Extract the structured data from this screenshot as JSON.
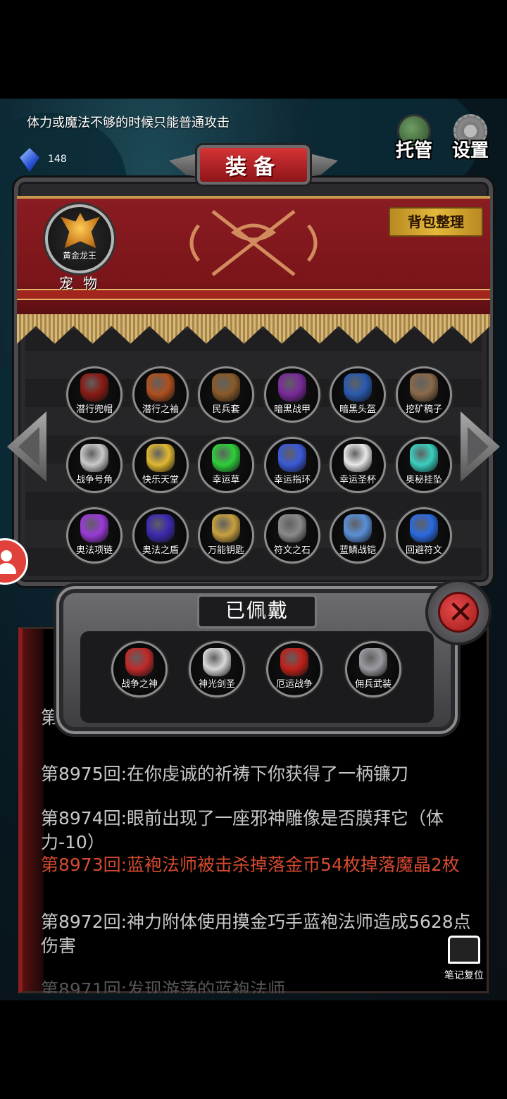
{
  "hint": "体力或魔法不够的时候只能普通攻击",
  "resource": {
    "icon": "crystal-gem-icon",
    "value": "148"
  },
  "top_buttons": [
    {
      "label": "托管",
      "icon": "auto-play-icon"
    },
    {
      "label": "设置",
      "icon": "gear-icon"
    }
  ],
  "panel": {
    "title": "装备",
    "sort_button": "背包整理",
    "pet": {
      "name": "黄金龙王",
      "label": "宠 物"
    }
  },
  "items": [
    {
      "label": "潜行兜帽",
      "icon": "hood-icon",
      "color": "#8a1a14"
    },
    {
      "label": "潜行之袖",
      "icon": "sleeve-icon",
      "color": "#b0501e"
    },
    {
      "label": "民兵套",
      "icon": "militia-set-icon",
      "color": "#8a5a2a"
    },
    {
      "label": "暗黑战甲",
      "icon": "dark-armor-icon",
      "color": "#7a2a9a"
    },
    {
      "label": "暗黑头盔",
      "icon": "dark-helmet-icon",
      "color": "#2a5ab0"
    },
    {
      "label": "挖矿稿子",
      "icon": "pickaxe-icon",
      "color": "#8a6a4a"
    },
    {
      "label": "战争号角",
      "icon": "war-horn-icon",
      "color": "#c9c9c9"
    },
    {
      "label": "快乐天堂",
      "icon": "golden-book-icon",
      "color": "#e0b830"
    },
    {
      "label": "幸运草",
      "icon": "clover-icon",
      "color": "#2ecf3a"
    },
    {
      "label": "幸运指环",
      "icon": "ring-icon",
      "color": "#3a5ad8"
    },
    {
      "label": "幸运圣杯",
      "icon": "chalice-icon",
      "color": "#e8e8e8"
    },
    {
      "label": "奥秘挂坠",
      "icon": "pendant-icon",
      "color": "#3ad0c0"
    },
    {
      "label": "奥法项链",
      "icon": "necklace-icon",
      "color": "#9a3ad8"
    },
    {
      "label": "奥法之盾",
      "icon": "arcane-shield-icon",
      "color": "#3a2ab0"
    },
    {
      "label": "万能钥匙",
      "icon": "key-icon",
      "color": "#c8a040"
    },
    {
      "label": "符文之石",
      "icon": "rune-stone-icon",
      "color": "#8a8a8a"
    },
    {
      "label": "蓝鳞战铠",
      "icon": "blue-scale-armor-icon",
      "color": "#5a90d8"
    },
    {
      "label": "回避符文",
      "icon": "evasion-rune-icon",
      "color": "#2a6ae0"
    }
  ],
  "equipped": {
    "title": "已佩戴",
    "items": [
      {
        "label": "战争之神",
        "icon": "war-god-icon",
        "color": "#c02a2a"
      },
      {
        "label": "神光剑圣",
        "icon": "sword-saint-icon",
        "color": "#d8d8d8"
      },
      {
        "label": "厄运战争",
        "icon": "doom-war-icon",
        "color": "#c0201a"
      },
      {
        "label": "佣兵武装",
        "icon": "mercenary-icon",
        "color": "#9a9aa0"
      }
    ]
  },
  "log": {
    "partial_top": "第",
    "lines": [
      {
        "text": "第8975回:在你虔诚的祈祷下你获得了一柄镰刀",
        "style": "normal"
      },
      {
        "text": "第8974回:眼前出现了一座邪神雕像是否膜拜它（体力-10）",
        "style": "normal"
      },
      {
        "text": "第8973回:蓝袍法师被击杀掉落金币54枚掉落魔晶2枚",
        "style": "red"
      },
      {
        "text": "第8972回:神力附体使用摸金巧手蓝袍法师造成5628点伤害",
        "style": "normal"
      },
      {
        "text": "第8971回:发现游荡的蓝袍法师",
        "style": "faint"
      }
    ]
  },
  "reset_button": "笔记复位"
}
